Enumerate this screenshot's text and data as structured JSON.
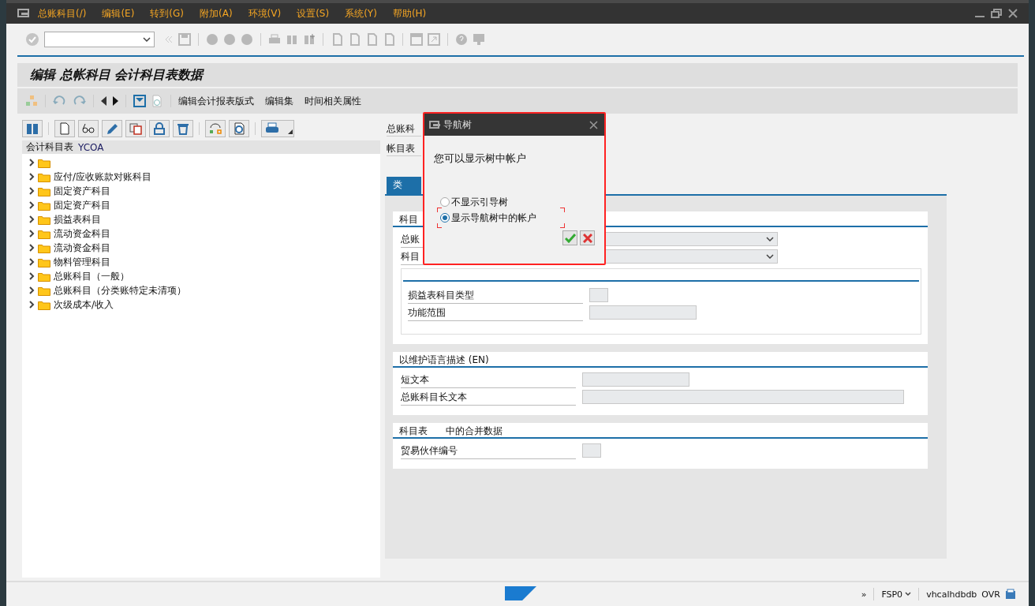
{
  "menu_bar": {
    "items": [
      "总账科目(/)",
      "编辑(E)",
      "转到(G)",
      "附加(A)",
      "环境(V)",
      "设置(S)",
      "系统(Y)",
      "帮助(H)"
    ]
  },
  "screen_title": "编辑 总帐科目 会计科目表数据",
  "app_toolbar": {
    "items": [
      "编辑会计报表版式",
      "编辑集",
      "时间相关属性"
    ]
  },
  "tree": {
    "header_label": "会计科目表",
    "header_value": "YCOA",
    "nodes": [
      {
        "expanded": false
      },
      {
        "label": "应付/应收账款对账科目",
        "expanded": false
      },
      {
        "label": "固定资产科目",
        "expanded": false
      },
      {
        "label": "固定资产科目",
        "expanded": false
      },
      {
        "label": "损益表科目",
        "expanded": false
      },
      {
        "label": "流动资金科目",
        "expanded": false
      },
      {
        "label": "流动资金科目",
        "expanded": false
      },
      {
        "label": "物料管理科目",
        "expanded": false
      },
      {
        "label": "总账科目（一般）",
        "expanded": false
      },
      {
        "label": "总账科目（分类账特定未清项）",
        "expanded": false
      },
      {
        "label": "次级成本/收入",
        "expanded": false
      }
    ]
  },
  "header_fields": [
    {
      "label": "总账科"
    },
    {
      "label": "帐目表"
    }
  ],
  "tabs": [
    {
      "label": "类",
      "selected": true
    }
  ],
  "sections": [
    {
      "title": "科目",
      "fields": [
        {
          "label": "总账",
          "kind": "dropdown"
        },
        {
          "label": "科目",
          "kind": "dropdown"
        }
      ],
      "group": {
        "fields": [
          {
            "label": "损益表科目类型",
            "kind": "code"
          },
          {
            "label": "功能范围",
            "kind": "text"
          }
        ]
      }
    },
    {
      "title": "以维护语言描述 (EN)",
      "fields": [
        {
          "label": "短文本",
          "kind": "text"
        },
        {
          "label": "总账科目长文本",
          "kind": "longtext"
        }
      ]
    },
    {
      "title": "科目表      中的合并数据",
      "fields": [
        {
          "label": "贸易伙伴编号",
          "kind": "code"
        }
      ]
    }
  ],
  "dialog": {
    "title": "导航树",
    "message": "您可以显示树中帐户",
    "options": [
      {
        "label": "不显示引导树",
        "selected": false
      },
      {
        "label": "显示导航树中的帐户",
        "selected": true
      }
    ]
  },
  "status_bar": {
    "overflow": "»",
    "system": "FSP0",
    "server": "vhcalhdbdb",
    "mode": "OVR"
  }
}
